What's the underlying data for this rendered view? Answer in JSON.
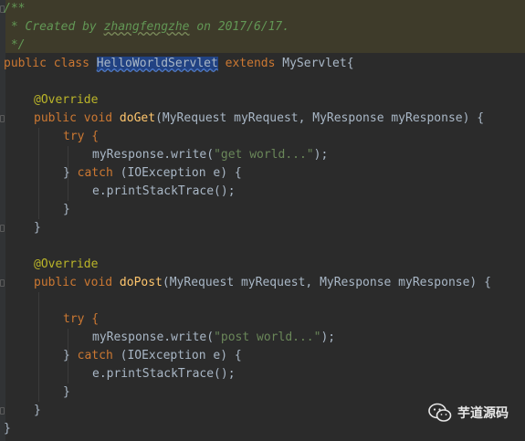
{
  "editor": {
    "lines": {
      "l0": "/**",
      "l1_prefix": " * Created by ",
      "l1_author": "zhangfengzhe",
      "l1_suffix": " on 2017/6/17.",
      "l2": " */",
      "l3_kw": "public class ",
      "l3_classname": "HelloWorldServlet",
      "l3_kw2": " extends ",
      "l3_rest": "MyServlet{",
      "l5": "@Override",
      "l6_kw": "public void ",
      "l6_fn": "doGet",
      "l6_rest": "(MyRequest myRequest, MyResponse myResponse) {",
      "l7": "try {",
      "l8_pre": "myResponse.write(",
      "l8_str": "\"get world...\"",
      "l8_post": ");",
      "l9_pre": "} ",
      "l9_kw": "catch",
      "l9_rest": " (IOException e) {",
      "l10": "e.printStackTrace();",
      "l11": "}",
      "l12": "}",
      "l14": "@Override",
      "l15_kw": "public void ",
      "l15_fn": "doPost",
      "l15_rest": "(MyRequest myRequest, MyResponse myResponse) {",
      "l17": "try {",
      "l18_pre": "myResponse.write(",
      "l18_str": "\"post world...\"",
      "l18_post": ");",
      "l19_pre": "} ",
      "l19_kw": "catch",
      "l19_rest": " (IOException e) {",
      "l20": "e.printStackTrace();",
      "l21": "}",
      "l22": "}",
      "l23": "}"
    }
  },
  "watermark": {
    "text": "芋道源码",
    "icon": "wechat-icon"
  },
  "colors": {
    "background": "#2b2b2b",
    "keyword": "#cc7832",
    "annotation": "#bbb529",
    "method": "#ffc66d",
    "string": "#6a8759",
    "doc_comment": "#629755",
    "plain": "#a9b7c6",
    "selection": "#214283"
  }
}
